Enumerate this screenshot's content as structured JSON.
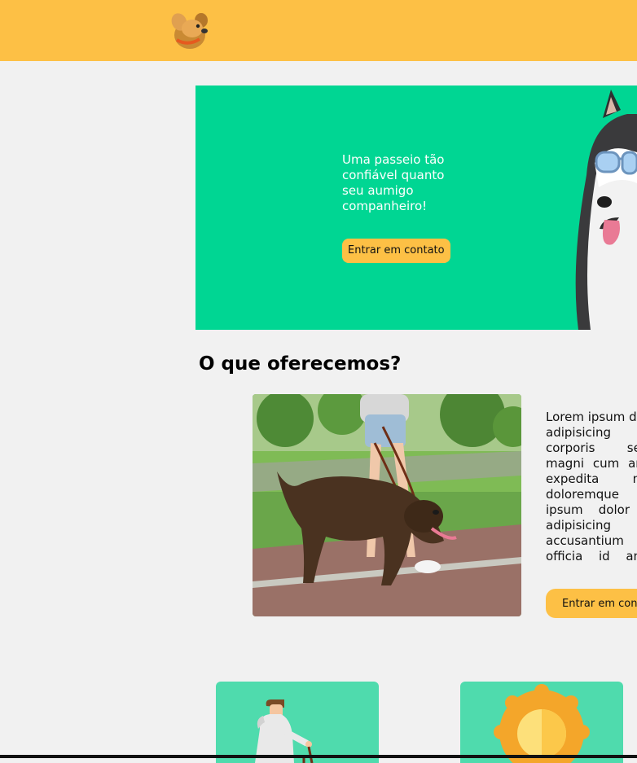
{
  "header": {
    "logo_icon": "dog-head-logo-icon"
  },
  "hero": {
    "tagline": "Uma passeio tão confiável quanto seu aumigo companheiro!",
    "cta_label": "Entrar em contato",
    "image_icon": "husky-sunglasses-image"
  },
  "services": {
    "title": "O que oferecemos?",
    "image_icon": "dog-walking-photo",
    "description_lines": [
      "Lorem ipsum dolor",
      "adipisicing elit.",
      "corporis sequi",
      "magni cum amet",
      "expedita nam",
      "doloremque sint",
      "ipsum dolor sit",
      "adipisicing elit.",
      "accusantium",
      "officia id animi"
    ],
    "cta_label": "Entrar em contato"
  },
  "cards": [
    {
      "icon": "person-walking-dog-icon"
    },
    {
      "icon": "sun-icon"
    }
  ],
  "colors": {
    "header": "#fdc045",
    "hero": "#00d693",
    "card": "#4fdbad",
    "button": "#fdc045",
    "background": "#f1f1f1"
  }
}
